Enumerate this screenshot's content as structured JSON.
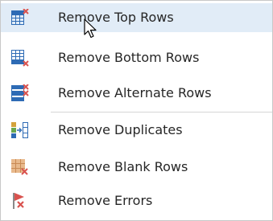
{
  "menu": {
    "items": [
      {
        "label": "Remove Top Rows",
        "icon": "remove-top-rows-icon",
        "highlighted": true
      },
      {
        "label": "Remove Bottom Rows",
        "icon": "remove-bottom-rows-icon"
      },
      {
        "label": "Remove Alternate Rows",
        "icon": "remove-alternate-rows-icon"
      },
      {
        "label": "Remove Duplicates",
        "icon": "remove-duplicates-icon"
      },
      {
        "label": "Remove Blank Rows",
        "icon": "remove-blank-rows-icon"
      },
      {
        "label": "Remove Errors",
        "icon": "remove-errors-icon"
      }
    ]
  },
  "colors": {
    "highlight": "#e1ecf7",
    "grid_blue": "#2e6bb5",
    "accent_red": "#d9534f",
    "text": "#262626"
  }
}
